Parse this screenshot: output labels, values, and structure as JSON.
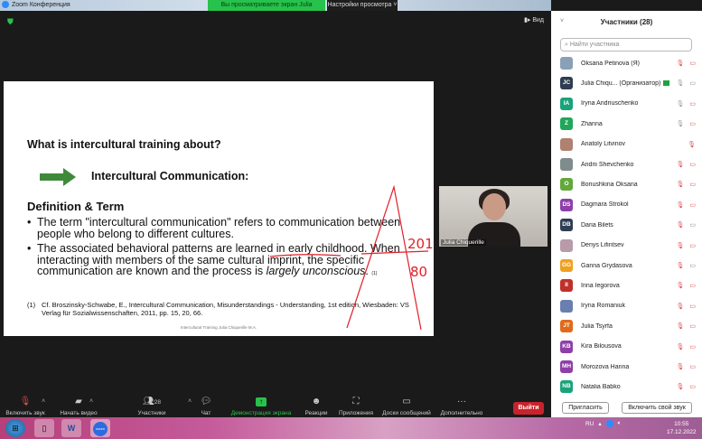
{
  "window": {
    "title": "Zoom Конференция",
    "banner": "Вы просматриваете экран Julia Chiquerille",
    "view_settings": "Настройки просмотра ˅",
    "view_button": "Вид"
  },
  "slide": {
    "title": "What is intercultural training about?",
    "subtitle": "Intercultural Communication:",
    "section": "Definition & Term",
    "bullet1": "The term \"intercultural communication\" refers to communication between people who belong to different cultures.",
    "bullet2_a": "The associated behavioral patterns are learned in ",
    "bullet2_u": "early childhood",
    "bullet2_b": ". When interacting with members of the same cultural imprint, the specific communication  are known and the process is ",
    "bullet2_i": "largely unconscious",
    "bullet2_c": ". ",
    "bullet2_ref": "(1)",
    "footnote_num": "(1)",
    "footnote": "Cf. Broszinsky-Schwabe, E., Intercultural Communication, Misunderstandings - Understanding, 1st edition, Wiesbaden: VS Verlag für Sozialwissenschaften, 2011, pp. 15, 20, 66.",
    "footer": "Intercultural Training Julia Chiquerille M.A.",
    "annotation_top": "201",
    "annotation_bottom": "80",
    "accent": "#3f8a3a",
    "ink": "#e0202a"
  },
  "video": {
    "name": "Julia Chiquerille"
  },
  "toolbar": {
    "mute": "Включить звук",
    "video": "Начать видео",
    "participants": "Участники",
    "participants_count": "28",
    "chat": "Чат",
    "share": "Демонстрация экрана",
    "reactions": "Реакции",
    "apps": "Приложения",
    "whiteboards": "Доски сообщений",
    "more": "Дополнительно",
    "leave": "Выйти"
  },
  "panel": {
    "title": "Участники (28)",
    "search_placeholder": "Найти участника",
    "invite": "Пригласить",
    "unmute_self": "Включить свой звук",
    "participants": [
      {
        "name": "Oksana Petinova (Я)",
        "initials": "",
        "color": "#8aa0b8",
        "mic": "muted",
        "cam": "off"
      },
      {
        "name": "Julia Chiqu...",
        "role": "(Организатор)",
        "initials": "JC",
        "color": "#2e3d52",
        "mic": "on",
        "cam": "on"
      },
      {
        "name": "Iryna Andriuschenko",
        "initials": "IA",
        "color": "#1aa37a",
        "mic": "on",
        "cam": "off"
      },
      {
        "name": "Zhanna",
        "initials": "Z",
        "color": "#21a65b",
        "mic": "on",
        "cam": "off"
      },
      {
        "name": "Anatoly Litvinov",
        "initials": "",
        "color": "#b08070",
        "mic": "muted",
        "cam": "none"
      },
      {
        "name": "Andrii Shevchenko",
        "initials": "",
        "color": "#7f8c8d",
        "mic": "muted",
        "cam": "off"
      },
      {
        "name": "Boriushkina Oksana",
        "initials": "O",
        "color": "#63a83a",
        "mic": "muted",
        "cam": "off"
      },
      {
        "name": "Dagmara Strokol",
        "initials": "DS",
        "color": "#8e3fa8",
        "mic": "muted",
        "cam": "off"
      },
      {
        "name": "Daria Bilets",
        "initials": "DB",
        "color": "#2e3d52",
        "mic": "muted",
        "cam": "on"
      },
      {
        "name": "Denys Lifintsev",
        "initials": "",
        "color": "#b89aa8",
        "mic": "muted",
        "cam": "off"
      },
      {
        "name": "Ganna Grydasova",
        "initials": "GG",
        "color": "#f0a020",
        "mic": "muted",
        "cam": "on"
      },
      {
        "name": "Irina Iegorova",
        "initials": "II",
        "color": "#c0302a",
        "mic": "muted",
        "cam": "off"
      },
      {
        "name": "Iryna Romaniuk",
        "initials": "",
        "color": "#6a7fb0",
        "mic": "muted",
        "cam": "off"
      },
      {
        "name": "Julia Tsyrfa",
        "initials": "JT",
        "color": "#e06a1a",
        "mic": "muted",
        "cam": "off"
      },
      {
        "name": "Kira Bilousova",
        "initials": "KB",
        "color": "#8e3fa8",
        "mic": "muted",
        "cam": "off"
      },
      {
        "name": "Morozova Hanna",
        "initials": "MH",
        "color": "#8e3fa8",
        "mic": "muted",
        "cam": "off"
      },
      {
        "name": "Natalia Babko",
        "initials": "NB",
        "color": "#1aa37a",
        "mic": "muted",
        "cam": "off"
      }
    ]
  },
  "taskbar": {
    "language": "RU",
    "time": "10:55",
    "date": "17.12.2022",
    "word": "W",
    "zoom": "zoom"
  }
}
